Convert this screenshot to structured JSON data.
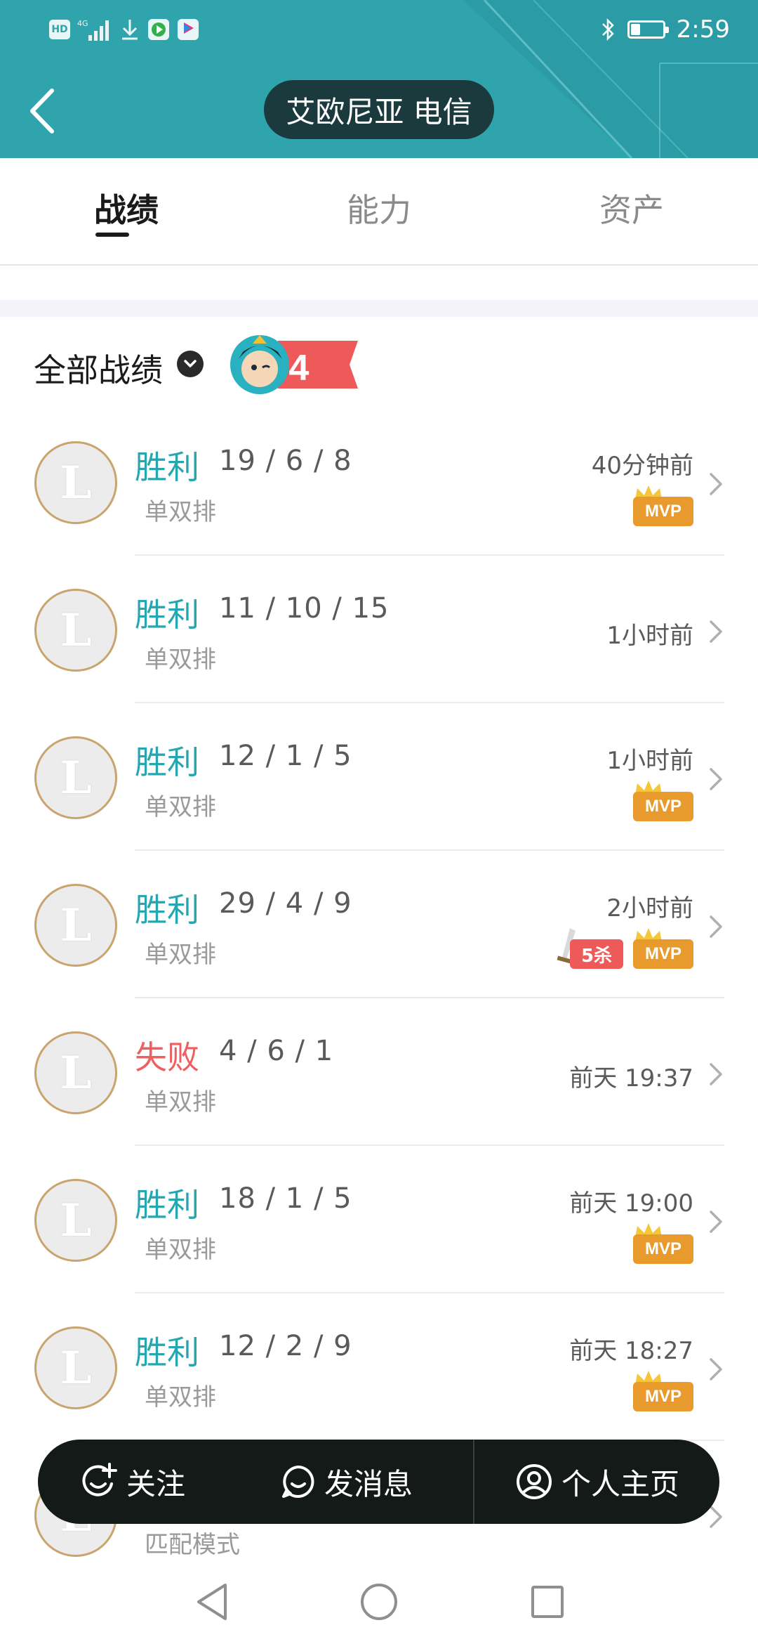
{
  "status_bar": {
    "icons": [
      "HD",
      "4G",
      "signal-icon",
      "download-icon",
      "video-app-icon",
      "youku-icon"
    ],
    "time": "2:59",
    "battery_level": 0.3
  },
  "header": {
    "title": "艾欧尼亚 电信",
    "back_icon": "back-arrow-icon",
    "bg_color": "#2fa4ad"
  },
  "tabs": [
    {
      "label": "战绩",
      "active": true
    },
    {
      "label": "能力",
      "active": false
    },
    {
      "label": "资产",
      "active": false
    }
  ],
  "filter": {
    "label": "全部战绩",
    "streak_badge": "4连胜"
  },
  "matches": [
    {
      "result": "胜利",
      "win": true,
      "kda": "19 / 6 / 8",
      "mode": "单双排",
      "time": "40分钟前",
      "badges": [
        "MVP"
      ]
    },
    {
      "result": "胜利",
      "win": true,
      "kda": "11 / 10 / 15",
      "mode": "单双排",
      "time": "1小时前",
      "badges": []
    },
    {
      "result": "胜利",
      "win": true,
      "kda": "12 / 1 / 5",
      "mode": "单双排",
      "time": "1小时前",
      "badges": [
        "MVP"
      ]
    },
    {
      "result": "胜利",
      "win": true,
      "kda": "29 / 4 / 9",
      "mode": "单双排",
      "time": "2小时前",
      "badges": [
        "5杀",
        "MVP"
      ]
    },
    {
      "result": "失败",
      "win": false,
      "kda": "4 / 6 / 1",
      "mode": "单双排",
      "time": "前天 19:37",
      "badges": []
    },
    {
      "result": "胜利",
      "win": true,
      "kda": "18 / 1 / 5",
      "mode": "单双排",
      "time": "前天 19:00",
      "badges": [
        "MVP"
      ]
    },
    {
      "result": "胜利",
      "win": true,
      "kda": "12 / 2 / 9",
      "mode": "单双排",
      "time": "前天 18:27",
      "badges": [
        "MVP"
      ]
    },
    {
      "result": "",
      "win": true,
      "kda": "",
      "mode": "匹配模式",
      "time": "",
      "badges": []
    }
  ],
  "action_bar": {
    "follow": "关注",
    "message": "发消息",
    "profile": "个人主页"
  },
  "colors": {
    "win": "#27a6b0",
    "loss": "#ef5f5f",
    "mvp": "#e89a2c",
    "penta": "#ee5a5a"
  }
}
